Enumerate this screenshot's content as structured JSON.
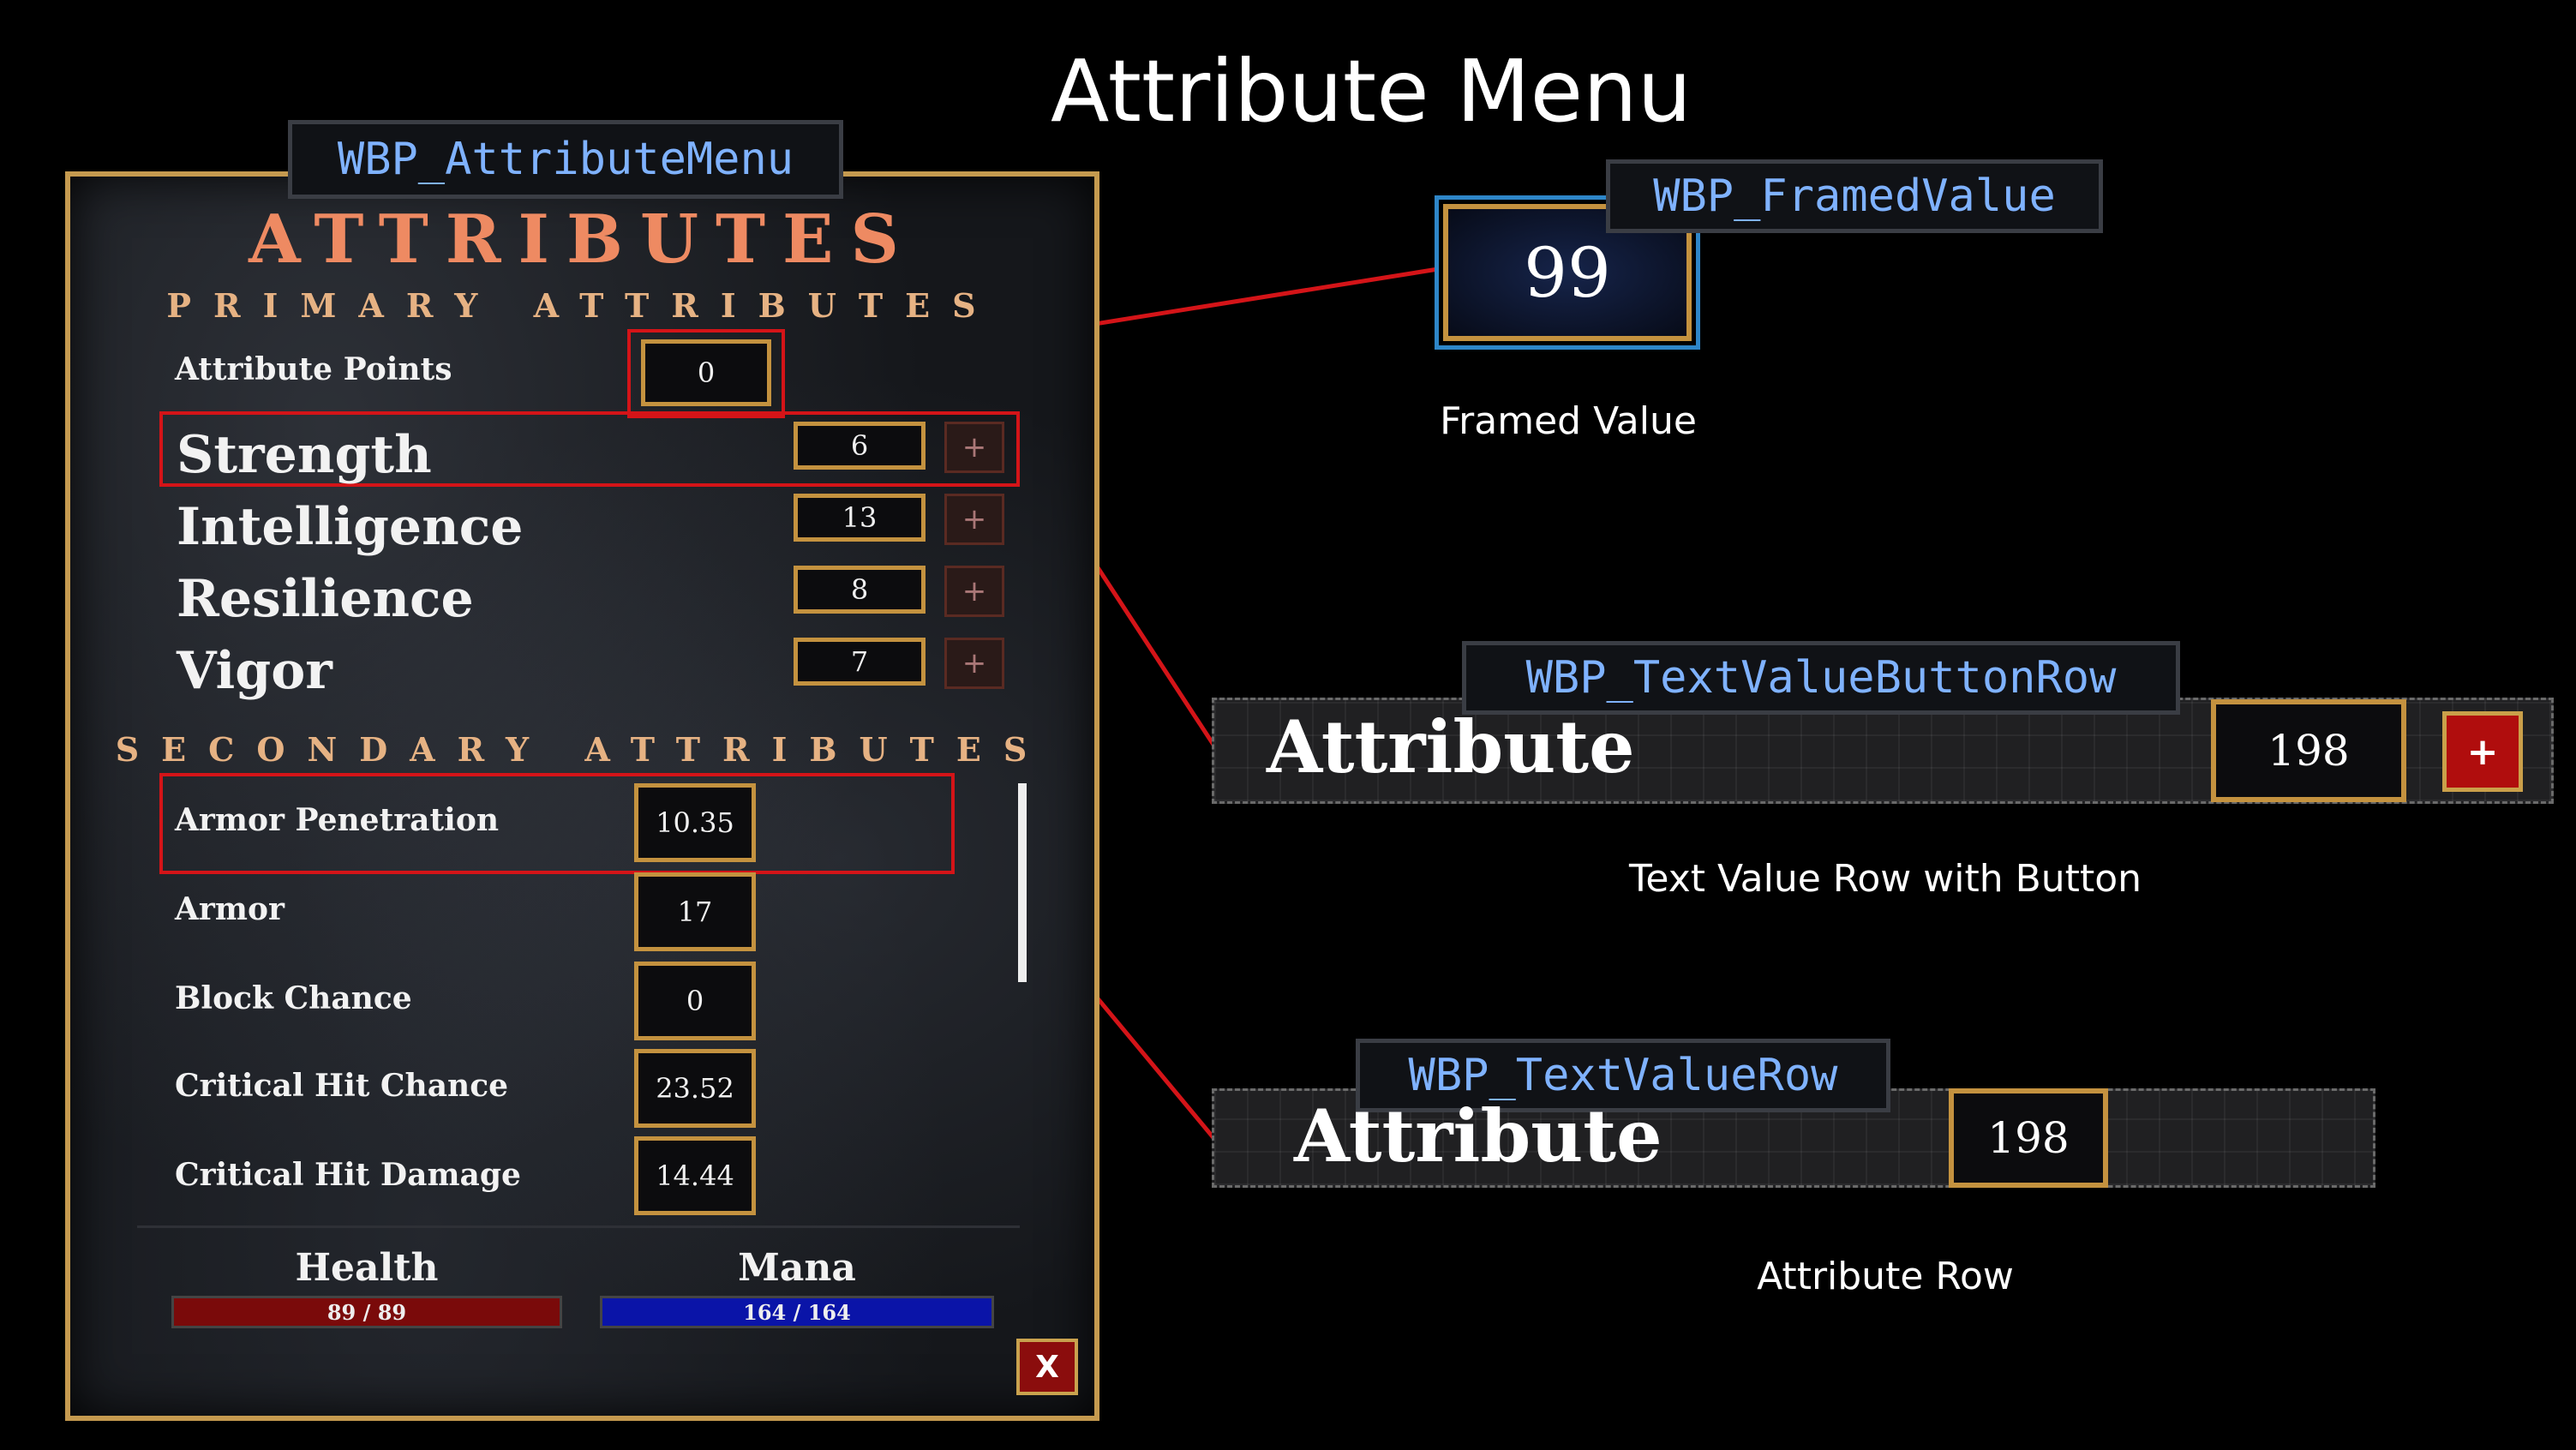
{
  "slide": {
    "title": "Attribute Menu"
  },
  "labels": {
    "attribute_menu": "WBP_AttributeMenu",
    "framed_value": "WBP_FramedValue",
    "text_value_button_row": "WBP_TextValueButtonRow",
    "text_value_row": "WBP_TextValueRow"
  },
  "menu": {
    "title": "ATTRIBUTES",
    "primary_title": "PRIMARY ATTRIBUTES",
    "secondary_title": "SECONDARY ATTRIBUTES",
    "attribute_points": {
      "label": "Attribute Points",
      "value": "0"
    },
    "primary": [
      {
        "label": "Strength",
        "value": "6",
        "button": "+"
      },
      {
        "label": "Intelligence",
        "value": "13",
        "button": "+"
      },
      {
        "label": "Resilience",
        "value": "8",
        "button": "+"
      },
      {
        "label": "Vigor",
        "value": "7",
        "button": "+"
      }
    ],
    "secondary": [
      {
        "label": "Armor Penetration",
        "value": "10.35"
      },
      {
        "label": "Armor",
        "value": "17"
      },
      {
        "label": "Block Chance",
        "value": "0"
      },
      {
        "label": "Critical Hit Chance",
        "value": "23.52"
      },
      {
        "label": "Critical Hit Damage",
        "value": "14.44"
      }
    ],
    "health": {
      "label": "Health",
      "text": "89 / 89",
      "fraction": 1.0,
      "color": "#7a0a0a"
    },
    "mana": {
      "label": "Mana",
      "text": "164 / 164",
      "fraction": 1.0,
      "color": "#0a14a8"
    },
    "close": "X"
  },
  "framed_value": {
    "value": "99",
    "caption": "Framed Value"
  },
  "button_row": {
    "label": "Attribute",
    "value": "198",
    "button": "+",
    "caption": "Text Value Row with Button"
  },
  "value_row": {
    "label": "Attribute",
    "value": "198",
    "caption": "Attribute Row"
  },
  "colors": {
    "highlight": "#d41418",
    "frame": "#c4923f",
    "code_label": "#7fb2ff"
  }
}
